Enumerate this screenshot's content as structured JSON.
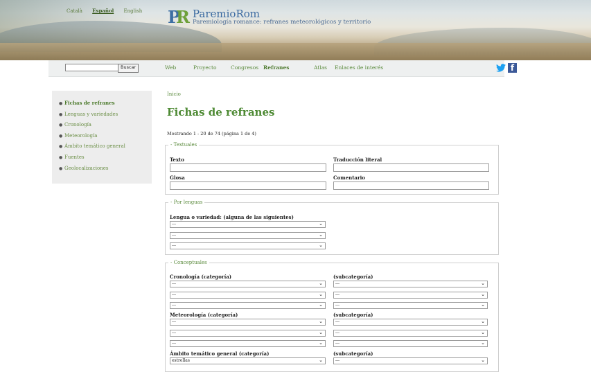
{
  "header": {
    "languages": [
      {
        "label": "Català",
        "active": false
      },
      {
        "label": "Español",
        "active": true
      },
      {
        "label": "English",
        "active": false
      }
    ],
    "logo": {
      "letters": "PR"
    },
    "site_title": "ParemioRom",
    "site_subtitle": "Paremiología romance: refranes meteorológicos y territorio"
  },
  "nav": {
    "search": {
      "value": "",
      "button_label": "Buscar"
    },
    "items": [
      {
        "label": "Web",
        "active": false
      },
      {
        "label": "Proyecto",
        "active": false
      },
      {
        "label": "Congresos",
        "active": false
      },
      {
        "label": "Refranes",
        "active": true
      },
      {
        "label": "Atlas",
        "active": false
      },
      {
        "label": "Enlaces de interés",
        "active": false
      }
    ],
    "social": [
      {
        "icon": "twitter-icon",
        "color": "#1da1f2"
      },
      {
        "icon": "facebook-icon",
        "color": "#3b5998",
        "glyph": "f"
      }
    ]
  },
  "sidebar": {
    "items": [
      {
        "label": "Fichas de refranes",
        "active": true
      },
      {
        "label": "Lenguas y variedades",
        "active": false
      },
      {
        "label": "Cronología",
        "active": false
      },
      {
        "label": "Meteorología",
        "active": false
      },
      {
        "label": "Ámbito temático general",
        "active": false
      },
      {
        "label": "Fuentes",
        "active": false
      },
      {
        "label": "Geolocalizaciones",
        "active": false
      }
    ]
  },
  "main": {
    "breadcrumb": "Inicio",
    "title": "Fichas de refranes",
    "results_info": "Mostrando 1 - 20 de 74 (página 1 de 4)",
    "textuales": {
      "legend": "- Textuales",
      "texto_label": "Texto",
      "traduccion_label": "Traducción literal",
      "glosa_label": "Glosa",
      "comentario_label": "Comentario"
    },
    "lenguas": {
      "legend": "- Por lenguas",
      "label": "Lengua o variedad: (alguna de las siguientes)",
      "selects": [
        "---",
        "---",
        "---"
      ]
    },
    "conceptuales": {
      "legend": "- Conceptuales",
      "cronologia_label": "Cronología (categoría)",
      "subcat_label": "(subcategoría)",
      "meteorologia_label": "Meteorología (categoría)",
      "ambito_label": "Ámbito temático general (categoría)",
      "cronologia_selects": [
        "---",
        "---",
        "---"
      ],
      "cronologia_sub_selects": [
        "---",
        "---",
        "---"
      ],
      "meteorologia_selects": [
        "---",
        "---",
        "---"
      ],
      "meteorologia_sub_selects": [
        "---",
        "---",
        "---"
      ],
      "ambito_select": "estrellas",
      "ambito_sub_select": "---"
    }
  },
  "colors": {
    "link_green": "#5a8a3c",
    "title_green": "#4e8a34",
    "logo_blue": "#3d6fa3",
    "nav_bg": "#eef0f0",
    "sidebar_bg": "#ededed"
  }
}
